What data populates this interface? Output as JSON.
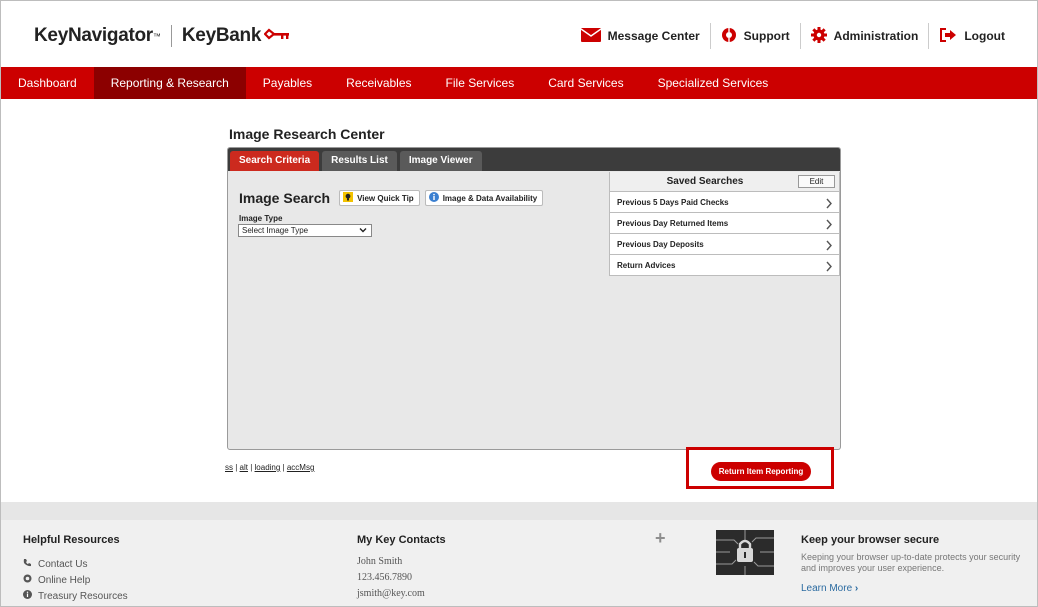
{
  "brand": {
    "product": "KeyNavigator",
    "tm": "™",
    "bank": "KeyBank"
  },
  "utility": {
    "message_center": "Message Center",
    "support": "Support",
    "administration": "Administration",
    "logout": "Logout"
  },
  "nav": {
    "items": [
      {
        "label": "Dashboard"
      },
      {
        "label": "Reporting & Research"
      },
      {
        "label": "Payables"
      },
      {
        "label": "Receivables"
      },
      {
        "label": "File Services"
      },
      {
        "label": "Card Services"
      },
      {
        "label": "Specialized Services"
      }
    ],
    "active": "Reporting & Research"
  },
  "page": {
    "title": "Image Research Center"
  },
  "tabs": [
    {
      "label": "Search Criteria",
      "active": true
    },
    {
      "label": "Results List",
      "active": false
    },
    {
      "label": "Image Viewer",
      "active": false
    }
  ],
  "search": {
    "title": "Image Search",
    "quick_tip": "View Quick Tip",
    "availability": "Image & Data Availability",
    "image_type_label": "Image Type",
    "image_type_value": "Select Image Type"
  },
  "saved": {
    "title": "Saved Searches",
    "edit": "Edit",
    "items": [
      "Previous 5 Days Paid Checks",
      "Previous Day Returned Items",
      "Previous Day Deposits",
      "Return Advices"
    ]
  },
  "debug_links": [
    "ss",
    "alt",
    "loading",
    "accMsg"
  ],
  "return_button": "Return Item Reporting",
  "footer": {
    "helpful": {
      "title": "Helpful Resources",
      "items": [
        "Contact Us",
        "Online Help",
        "Treasury Resources"
      ]
    },
    "contacts": {
      "title": "My Key Contacts",
      "name": "John Smith",
      "phone": "123.456.7890",
      "email": "jsmith@key.com"
    },
    "secure": {
      "title": "Keep your browser secure",
      "text": "Keeping your browser up-to-date protects your security and improves your user experience.",
      "learn_more": "Learn More"
    }
  },
  "colors": {
    "brand_red": "#cc0000",
    "nav_active": "#8c0000"
  }
}
